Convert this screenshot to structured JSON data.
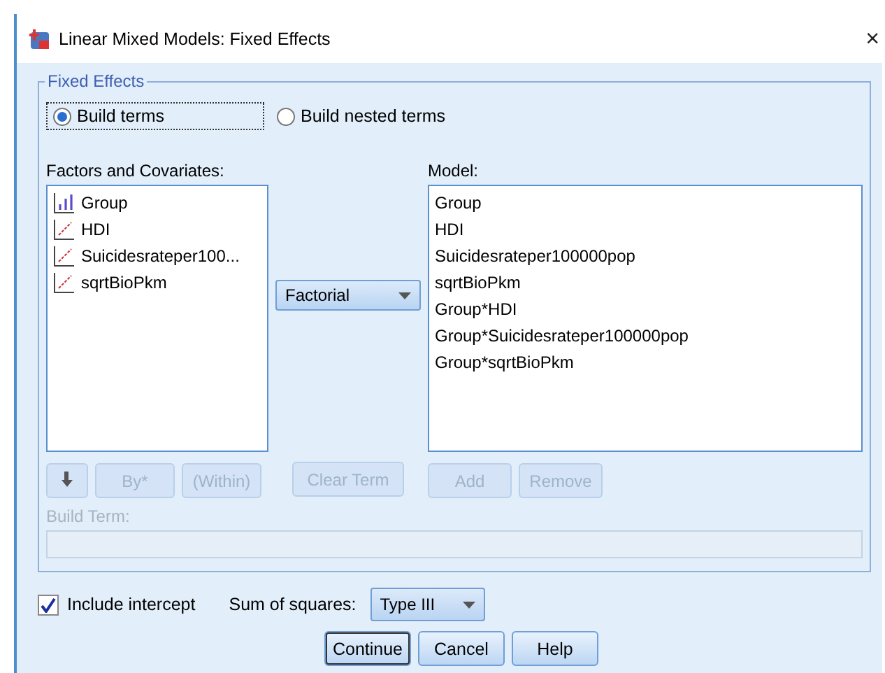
{
  "window": {
    "title": "Linear Mixed Models: Fixed Effects",
    "close": "×"
  },
  "fixed_effects": {
    "legend": "Fixed Effects",
    "modes": [
      {
        "label": "Build terms",
        "selected": true
      },
      {
        "label": "Build nested terms",
        "selected": false
      }
    ],
    "factors_label": "Factors and Covariates:",
    "variables": [
      {
        "name": "Group",
        "kind": "nominal"
      },
      {
        "name": "HDI",
        "kind": "scale"
      },
      {
        "name": "Suicidesrateper100...",
        "kind": "scale"
      },
      {
        "name": "sqrtBioPkm",
        "kind": "scale"
      }
    ],
    "term_type": "Factorial",
    "model_label": "Model:",
    "model_terms": [
      "Group",
      "HDI",
      "Suicidesrateper100000pop",
      "sqrtBioPkm",
      "Group*HDI",
      "Group*Suicidesrateper100000pop",
      "Group*sqrtBioPkm"
    ],
    "left_buttons": [
      {
        "label": "By*",
        "disabled": true
      },
      {
        "label": "(Within)",
        "disabled": true
      }
    ],
    "clear_term": {
      "label": "Clear Term",
      "disabled": true
    },
    "model_buttons": [
      {
        "label": "Add",
        "disabled": true
      },
      {
        "label": "Remove",
        "disabled": true
      }
    ],
    "build_term_label": "Build Term:"
  },
  "include_intercept": {
    "label": "Include intercept",
    "checked": true
  },
  "sum_of_squares": {
    "label": "Sum of squares:",
    "value": "Type III"
  },
  "buttons": [
    "Continue",
    "Cancel",
    "Help"
  ]
}
